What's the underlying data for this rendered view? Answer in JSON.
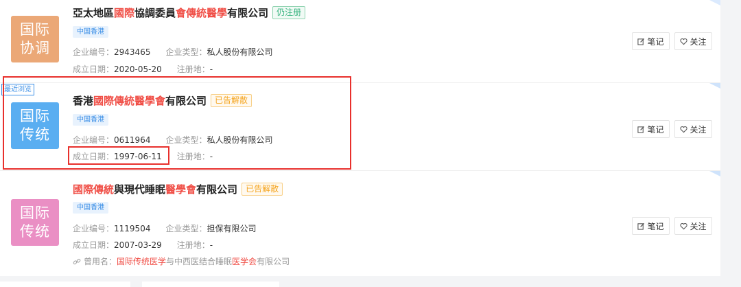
{
  "cards": [
    {
      "logo": {
        "line1": "国际",
        "line2": "协调",
        "color": "#eba877"
      },
      "title": {
        "a": "亞太地區",
        "hl1": "國際",
        "b": "協調委員",
        "hl2": "會傳統醫學",
        "c": "有限公司"
      },
      "status": "仍注册",
      "region": "中国香港",
      "reg_no_label": "企业编号：",
      "reg_no": "2943465",
      "type_label": "企业类型：",
      "type": "私人股份有限公司",
      "date_label": "成立日期：",
      "date": "2020-05-20",
      "place_label": "注册地：",
      "place": "-"
    },
    {
      "logo": {
        "line1": "国际",
        "line2": "传统",
        "color": "#5aaef1"
      },
      "title": {
        "a": "香港",
        "hl1": "國際傳統醫學會",
        "c": "有限公司"
      },
      "status": "已告解散",
      "region": "中国香港",
      "reg_no_label": "企业编号：",
      "reg_no": "0611964",
      "type_label": "企业类型：",
      "type": "私人股份有限公司",
      "date_label": "成立日期：",
      "date": "1997-06-11",
      "place_label": "注册地：",
      "place": "-"
    },
    {
      "logo": {
        "line1": "国际",
        "line2": "传统",
        "color": "#ea8fc4"
      },
      "title": {
        "hl1": "國際傳統",
        "a": "與現代睡眠",
        "hl2": "醫學會",
        "c": "有限公司"
      },
      "status": "已告解散",
      "region": "中国香港",
      "reg_no_label": "企业编号：",
      "reg_no": "1119504",
      "type_label": "企业类型：",
      "type": "担保有限公司",
      "date_label": "成立日期：",
      "date": "2007-03-29",
      "place_label": "注册地：",
      "place": "-",
      "former_label": "曾用名：",
      "former_hl1": "国际传统医学",
      "former_a": "与中西医结合睡眠",
      "former_hl2": "医学会",
      "former_b": "有限公司"
    }
  ],
  "buttons": {
    "note": "笔记",
    "follow": "关注"
  },
  "recent_tag": "最近浏览",
  "colors": {
    "highlight": "#f04f47",
    "accent": "#3a8ee6",
    "redbox": "#e8302c"
  },
  "icons": {
    "note": "edit-note-icon",
    "follow": "heart-icon",
    "history": "link-icon"
  }
}
